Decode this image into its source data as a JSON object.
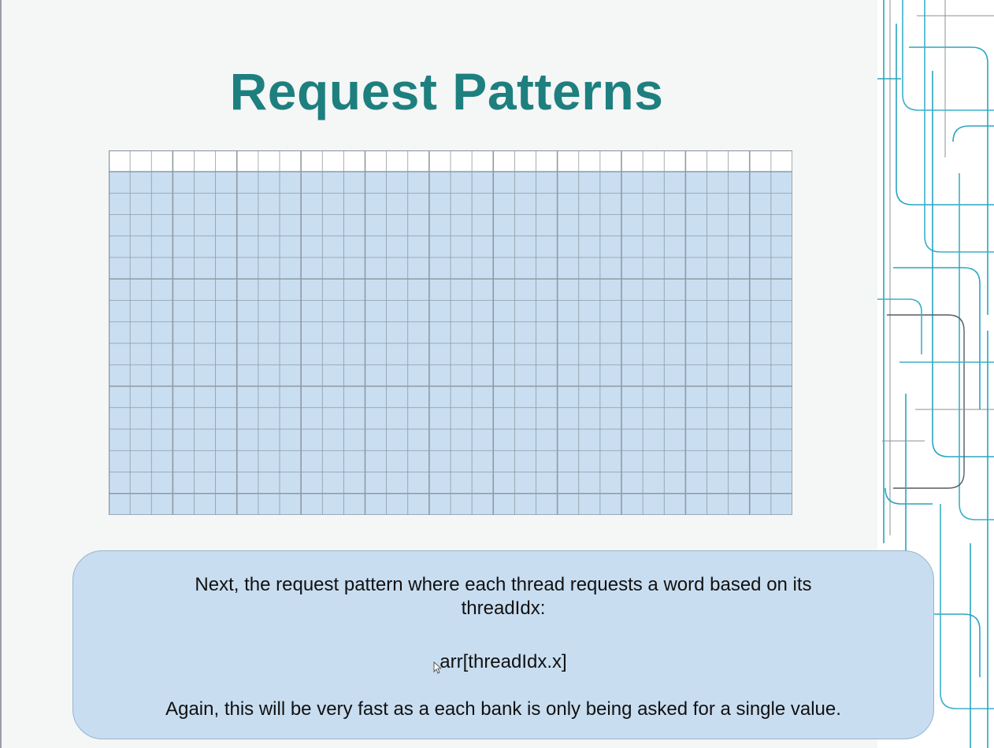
{
  "slide": {
    "title": "Request Patterns",
    "grid": {
      "columns": 32,
      "header_rows": 1,
      "body_rows": 16,
      "column_group_size": 3,
      "row_group_size": 5,
      "header_fill": "#ffffff",
      "body_fill": "#c9def1",
      "line_color": "#8e9aa4"
    },
    "note": {
      "line1": "Next, the request pattern where each thread requests a word based on its threadIdx:",
      "code": "arr[threadIdx.x]",
      "line3": "Again, this will be very fast as a each bank is only being asked for a single value."
    },
    "colors": {
      "title": "#1e7f7f",
      "note_bg": "#c8ddf0",
      "deco_teal": "#2aa5c0",
      "deco_gray": "#8a9096"
    }
  }
}
